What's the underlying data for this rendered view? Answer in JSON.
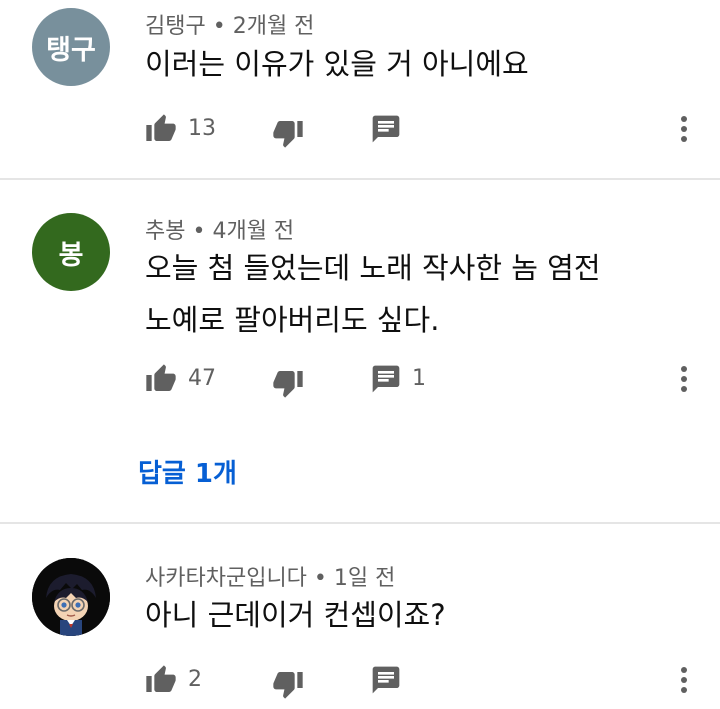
{
  "comments": [
    {
      "avatar_text": "탱구",
      "avatar_color": "#78909c",
      "author": "김탱구",
      "time": "• 2개월 전",
      "text_lines": [
        "이러는 이유가 있을 거 아니에요"
      ],
      "likes": "13",
      "replies": ""
    },
    {
      "avatar_text": "봉",
      "avatar_color": "#33691e",
      "author": "추봉",
      "time": "• 4개월 전",
      "text_lines": [
        "오늘 첨 들었는데 노래 작사한 놈 염전",
        "노예로 팔아버리도 싶다."
      ],
      "likes": "47",
      "replies": "1",
      "replies_link": "답글 1개"
    },
    {
      "avatar_text": "",
      "avatar_color": "#000000",
      "author": "사카타차군입니다",
      "time": "• 1일 전",
      "text_lines": [
        "아니 근데이거 컨셉이죠?"
      ],
      "likes": "2",
      "replies": ""
    }
  ],
  "icons": {
    "like": "thumb-up-icon",
    "dislike": "thumb-down-icon",
    "reply": "comment-icon",
    "more": "more-vert-icon"
  },
  "colors": {
    "icon": "#606060",
    "link": "#065fd4",
    "divider": "#e5e5e5"
  }
}
